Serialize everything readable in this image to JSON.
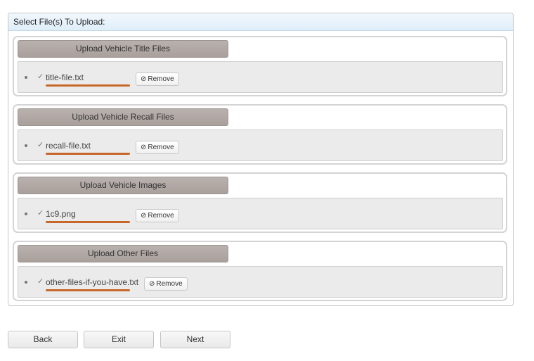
{
  "panel": {
    "title": "Select File(s) To Upload:"
  },
  "sections": [
    {
      "button": "Upload Vehicle Title Files",
      "file": "title-file.txt",
      "remove": "Remove"
    },
    {
      "button": "Upload Vehicle Recall Files",
      "file": "recall-file.txt",
      "remove": "Remove"
    },
    {
      "button": "Upload Vehicle Images",
      "file": "1c9.png",
      "remove": "Remove"
    },
    {
      "button": "Upload Other Files",
      "file": "other-files-if-you-have.txt",
      "remove": "Remove"
    }
  ],
  "icons": {
    "check": "check-icon",
    "remove": "ban-icon"
  },
  "accent": "#c8672a",
  "nav": {
    "back": "Back",
    "exit": "Exit",
    "next": "Next"
  }
}
